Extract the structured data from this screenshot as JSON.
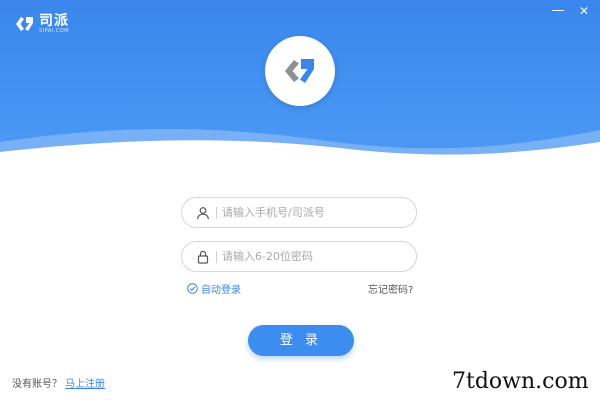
{
  "app": {
    "brand_name": "司派",
    "brand_domain": "SIPAI.COM"
  },
  "window_controls": {
    "minimize": "—",
    "close": "✕"
  },
  "icons": {
    "brand": "sipai-logo-icon",
    "main_logo": "sipai-logo-icon",
    "user": "user-icon",
    "lock": "lock-icon",
    "check": "check-circle-icon"
  },
  "colors": {
    "accent": "#3a86ec",
    "button": "#3d8cf0",
    "logo_gray": "#8c8f95"
  },
  "form": {
    "username_placeholder": "请输入手机号/司派号",
    "password_placeholder": "请输入6-20位密码",
    "auto_login": "自动登录",
    "forgot_password": "忘记密码?",
    "login_button": "登 录"
  },
  "footer": {
    "no_account": "没有账号？",
    "register_link": "马上注册"
  },
  "watermark": "7tdown.com"
}
